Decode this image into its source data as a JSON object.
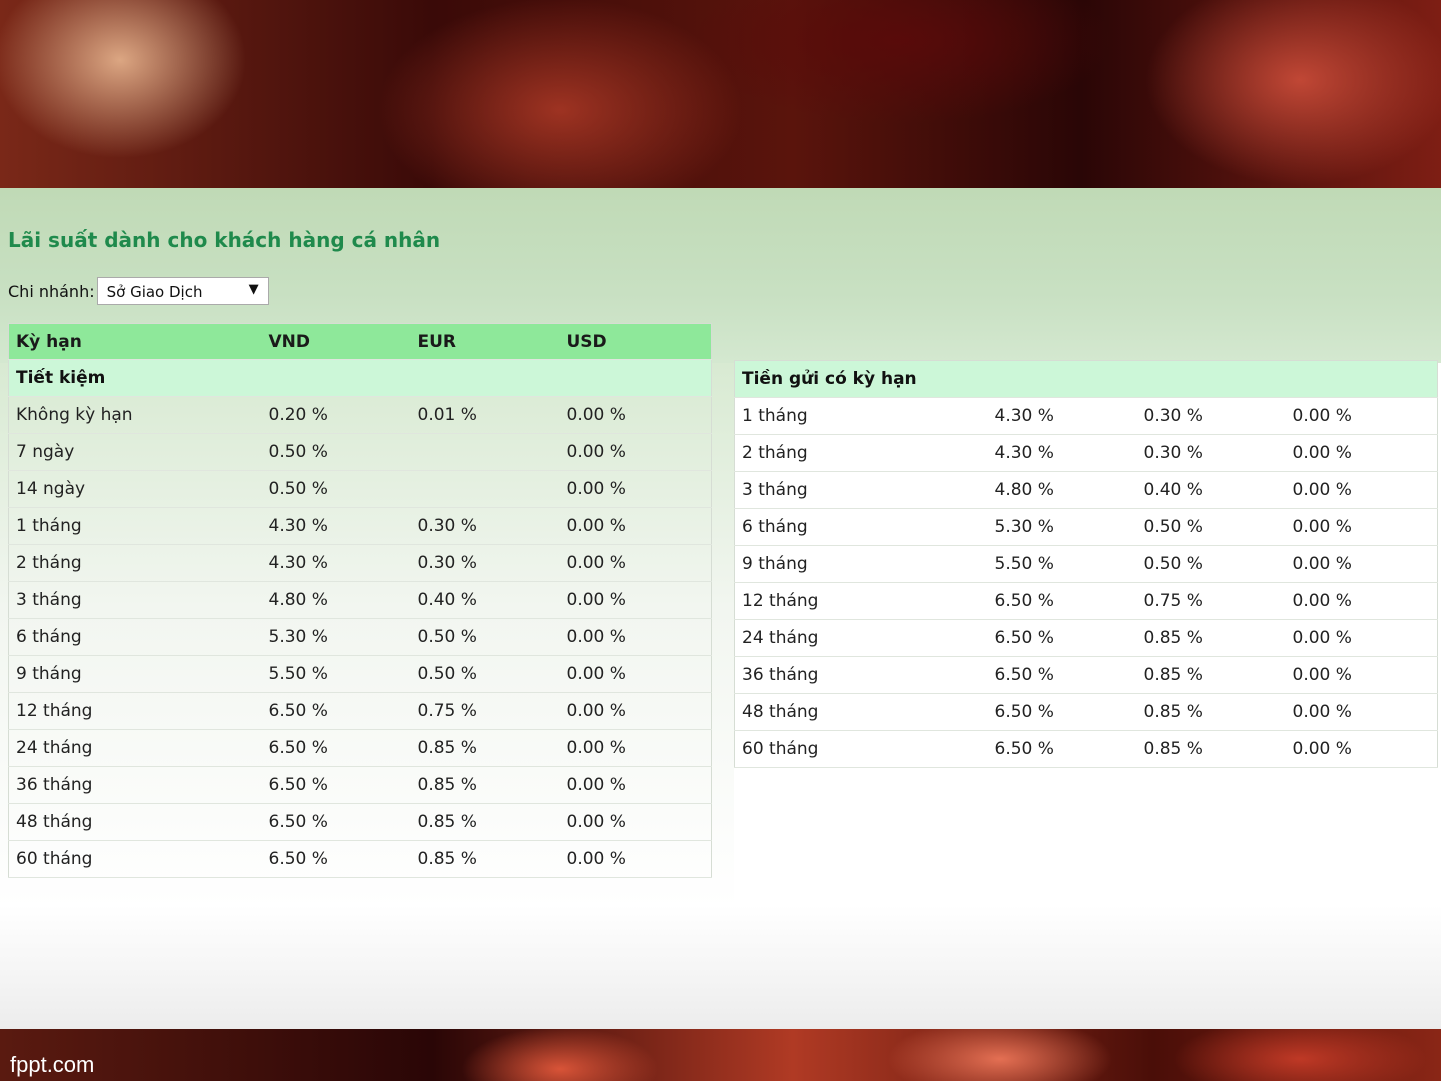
{
  "footer": {
    "site": "fppt.com"
  },
  "page": {
    "title": "Lãi suất dành cho khách hàng cá nhân"
  },
  "branch": {
    "label": "Chi nhánh:",
    "selected": "Sở Giao Dịch"
  },
  "headers": [
    "Kỳ hạn",
    "VND",
    "EUR",
    "USD"
  ],
  "savings": {
    "section_title": "Tiết kiệm",
    "rows": [
      [
        "Không kỳ hạn",
        "0.20 %",
        "0.01 %",
        "0.00 %"
      ],
      [
        "7 ngày",
        "0.50 %",
        "",
        "0.00 %"
      ],
      [
        "14 ngày",
        "0.50 %",
        "",
        "0.00 %"
      ],
      [
        "1 tháng",
        "4.30 %",
        "0.30 %",
        "0.00 %"
      ],
      [
        "2 tháng",
        "4.30 %",
        "0.30 %",
        "0.00 %"
      ],
      [
        "3 tháng",
        "4.80 %",
        "0.40 %",
        "0.00 %"
      ],
      [
        "6 tháng",
        "5.30 %",
        "0.50 %",
        "0.00 %"
      ],
      [
        "9 tháng",
        "5.50 %",
        "0.50 %",
        "0.00 %"
      ],
      [
        "12 tháng",
        "6.50 %",
        "0.75 %",
        "0.00 %"
      ],
      [
        "24 tháng",
        "6.50 %",
        "0.85 %",
        "0.00 %"
      ],
      [
        "36 tháng",
        "6.50 %",
        "0.85 %",
        "0.00 %"
      ],
      [
        "48 tháng",
        "6.50 %",
        "0.85 %",
        "0.00 %"
      ],
      [
        "60 tháng",
        "6.50 %",
        "0.85 %",
        "0.00 %"
      ]
    ]
  },
  "term_deposit": {
    "section_title": "Tiền gửi có kỳ hạn",
    "rows": [
      [
        "1 tháng",
        "4.30 %",
        "0.30 %",
        "0.00 %"
      ],
      [
        "2 tháng",
        "4.30 %",
        "0.30 %",
        "0.00 %"
      ],
      [
        "3 tháng",
        "4.80 %",
        "0.40 %",
        "0.00 %"
      ],
      [
        "6 tháng",
        "5.30 %",
        "0.50 %",
        "0.00 %"
      ],
      [
        "9 tháng",
        "5.50 %",
        "0.50 %",
        "0.00 %"
      ],
      [
        "12 tháng",
        "6.50 %",
        "0.75 %",
        "0.00 %"
      ],
      [
        "24 tháng",
        "6.50 %",
        "0.85 %",
        "0.00 %"
      ],
      [
        "36 tháng",
        "6.50 %",
        "0.85 %",
        "0.00 %"
      ],
      [
        "48 tháng",
        "6.50 %",
        "0.85 %",
        "0.00 %"
      ],
      [
        "60 tháng",
        "6.50 %",
        "0.85 %",
        "0.00 %"
      ]
    ]
  }
}
